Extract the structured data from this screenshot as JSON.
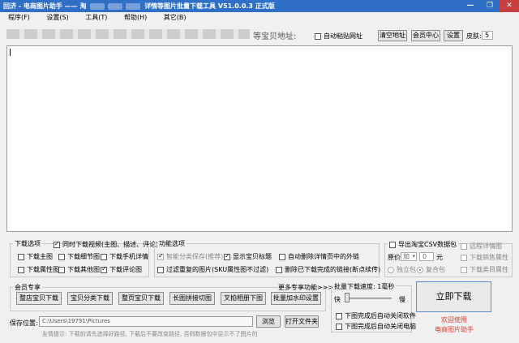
{
  "window": {
    "title_prefix": "回济 - 电商图片助手 —— 淘",
    "title_suffix": "详情等图片批量下载工具 V51.0.0.3 正式版",
    "controls": [
      "—",
      "❐",
      "✕"
    ]
  },
  "menu": [
    "程序(F)",
    "设置(S)",
    "工具(T)",
    "帮助(H)",
    "其它(B)"
  ],
  "address": {
    "label": "等宝贝地址:",
    "auto_paste": "自动粘贴网址",
    "clear_btn": "清空地址",
    "member_btn": "会员中心",
    "settings_btn": "设置",
    "skin_label": "皮肤:",
    "skin_value": "5"
  },
  "download_options": {
    "title": "下载选项",
    "video": "同时下载视频(主图、描述、评论)",
    "items": [
      {
        "label": "下载主图",
        "checked": false
      },
      {
        "label": "下载细节图",
        "checked": false
      },
      {
        "label": "下载手机详情",
        "checked": false
      },
      {
        "label": "下载属性图",
        "checked": false
      },
      {
        "label": "下载其他图",
        "checked": false
      },
      {
        "label": "下载评论图",
        "checked": true
      }
    ]
  },
  "function_options": {
    "title": "功能选项",
    "smart_save": "智能分类保存(推荐)",
    "show_title": "显示宝贝标题",
    "auto_delete": "自动删除详情页中的外链",
    "filter_dup": "过滤重复的图片(SKU属性图不过滤)",
    "delete_done": "删除已下载完成的链接(断点续传)"
  },
  "csv": {
    "export": "导出淘宝CSV数据包",
    "remote_detail": "远程详情图",
    "price_label": "原价",
    "price_op": "加",
    "price_value": "0",
    "price_unit": "元",
    "sale_attr": "下载销售属性",
    "independent": "独立包",
    "combined": "复合包",
    "product_attr": "下载类目属性"
  },
  "member": {
    "title": "会员专享",
    "more": "更多专享功能>>>",
    "buttons": [
      "整店宝贝下载",
      "宝贝分类下载",
      "整页宝贝下载",
      "长图拼接切图",
      "叉拍相册下图",
      "批量加水印设置"
    ]
  },
  "speed": {
    "title": "批量下载速度: 1毫秒",
    "fast": "快",
    "slow": "慢",
    "value_percent": 0,
    "close_software": "下图完成后自动关闭软件",
    "close_pc": "下图完成后自动关闭电脑"
  },
  "download_btn": "立即下载",
  "welcome": "欢迎使用",
  "product": "电商图片助手",
  "save": {
    "label": "保存位置:",
    "path": "C:\\Users\\19791\\Pictures",
    "browse": "浏览",
    "open": "打开文件夹",
    "tip": "友情提示: 下载前请先选择好路径, 下载后不要改变路径, 否则数据包中显示不了图片的"
  }
}
